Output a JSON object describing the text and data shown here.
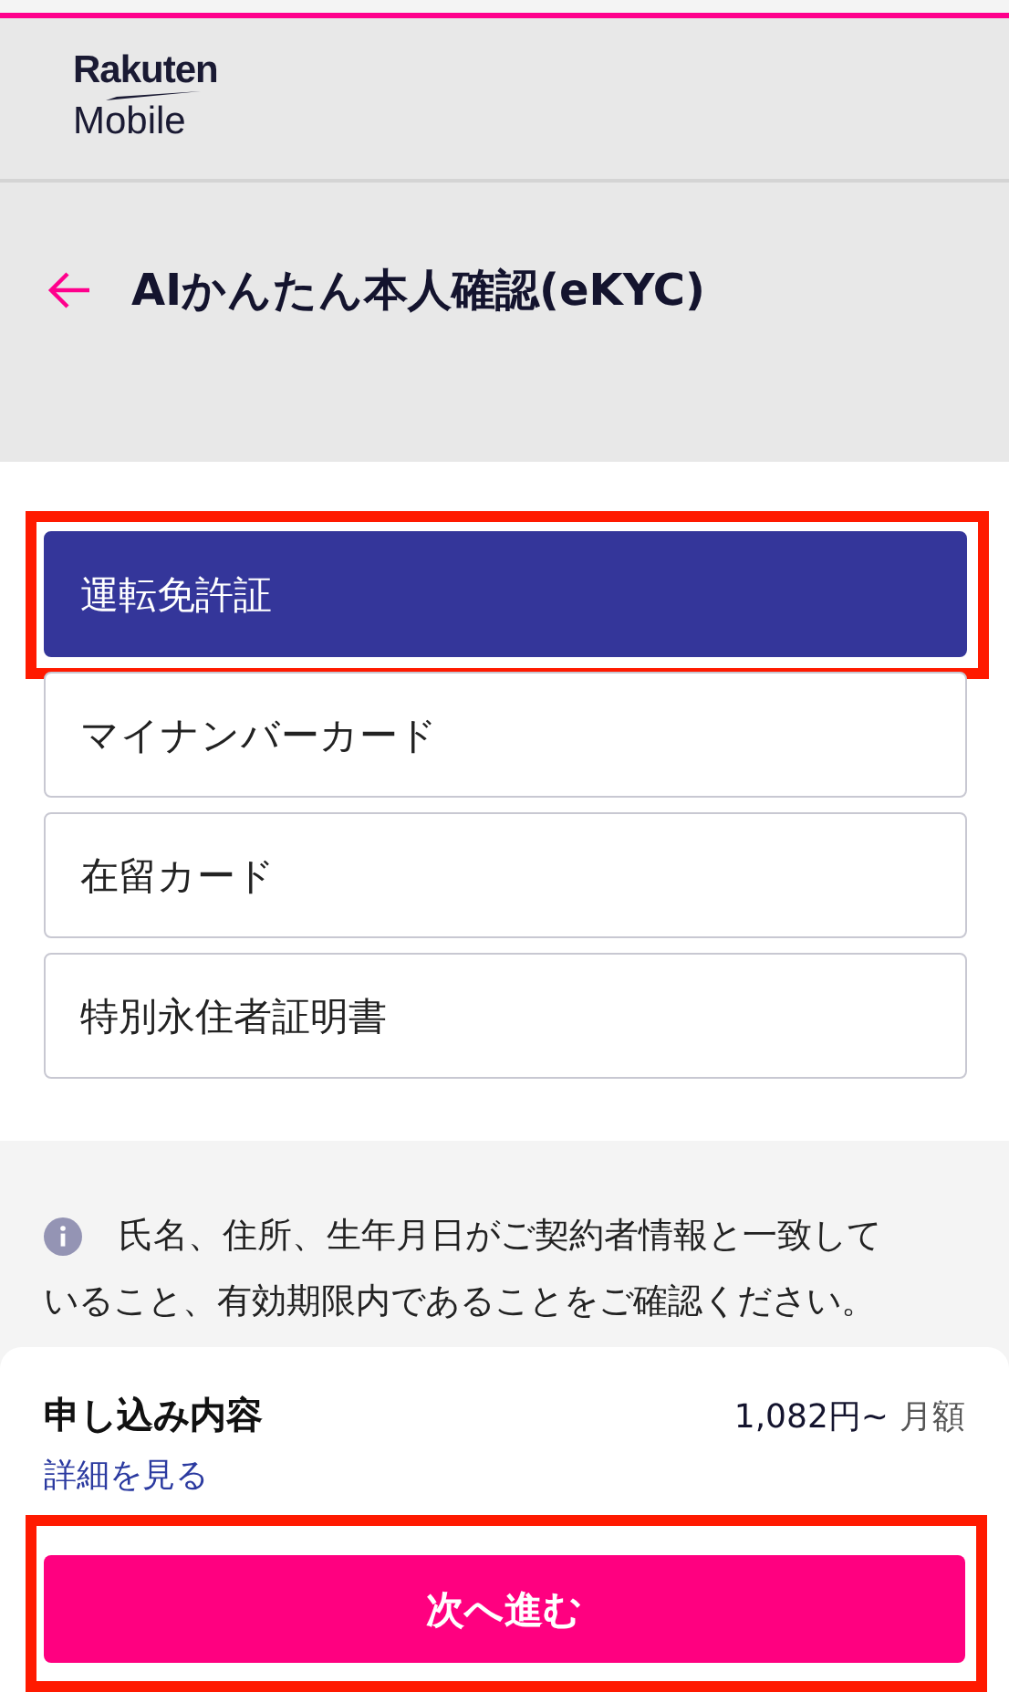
{
  "header": {
    "logo_top": "Rakuten",
    "logo_bottom": "Mobile"
  },
  "page_title": "AIかんたん本人確認(eKYC)",
  "document_options": [
    {
      "label": "運転免許証",
      "selected": true,
      "highlighted": true
    },
    {
      "label": "マイナンバーカード",
      "selected": false,
      "highlighted": false
    },
    {
      "label": "在留カード",
      "selected": false,
      "highlighted": false
    },
    {
      "label": "特別永住者証明書",
      "selected": false,
      "highlighted": false
    }
  ],
  "notice_lines": [
    "氏名、住所、生年月日がご契約者情報と一致して",
    "いること、有効期限内であることをご確認ください。"
  ],
  "summary": {
    "title": "申し込み内容",
    "price": "1,082円~",
    "period": "月額",
    "details_link": "詳細を見る"
  },
  "next_button": {
    "label": "次へ進む",
    "highlighted": true
  }
}
